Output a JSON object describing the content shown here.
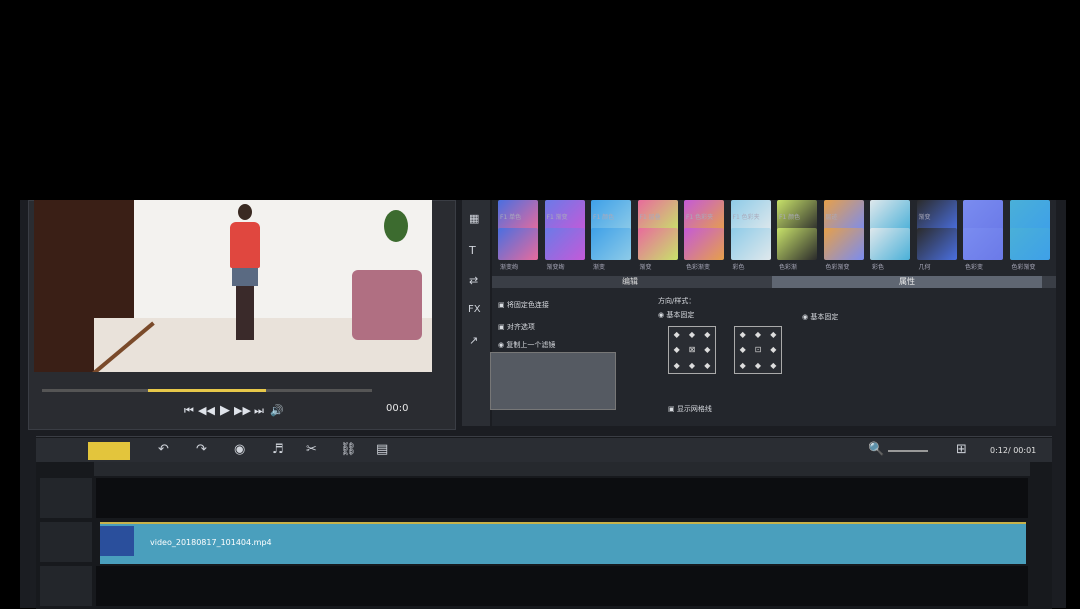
{
  "preview": {
    "timecode": "00:0",
    "controls": [
      "⏮",
      "◀◀",
      "▶",
      "▶▶",
      "⏭",
      "🔊"
    ]
  },
  "library": {
    "row1": [
      "F1 单色",
      "F1 渐变",
      "F1 颜色",
      "F1 层叠",
      "F1 色彩夹",
      "F1 色彩夹",
      "F1 颜色",
      "层迹",
      "",
      "渐变",
      "",
      ""
    ],
    "row2": [
      "渐变绚",
      "渐变绚",
      "渐变",
      "渐变",
      "色彩渐变",
      "彩色",
      "色彩渐",
      "色彩渐变",
      "彩色",
      "几何",
      "色彩变",
      "色彩渐变"
    ],
    "tab_left": "编辑",
    "tab_right": "属性",
    "direction_label": "方向/样式：",
    "option1": "将固定色连接",
    "option2": "对齐选项",
    "option3": "复制上一个滤镜",
    "chk_center": "基本固定",
    "chk_right": "基本固定",
    "chk_bottom": "显示网格线"
  },
  "timeline": {
    "clip_name": "video_20180817_101404.mp4",
    "time_right": "0:12/ 00:01"
  },
  "colors": {
    "accent": "#e3c53c",
    "clip": "#4a9fbd"
  }
}
